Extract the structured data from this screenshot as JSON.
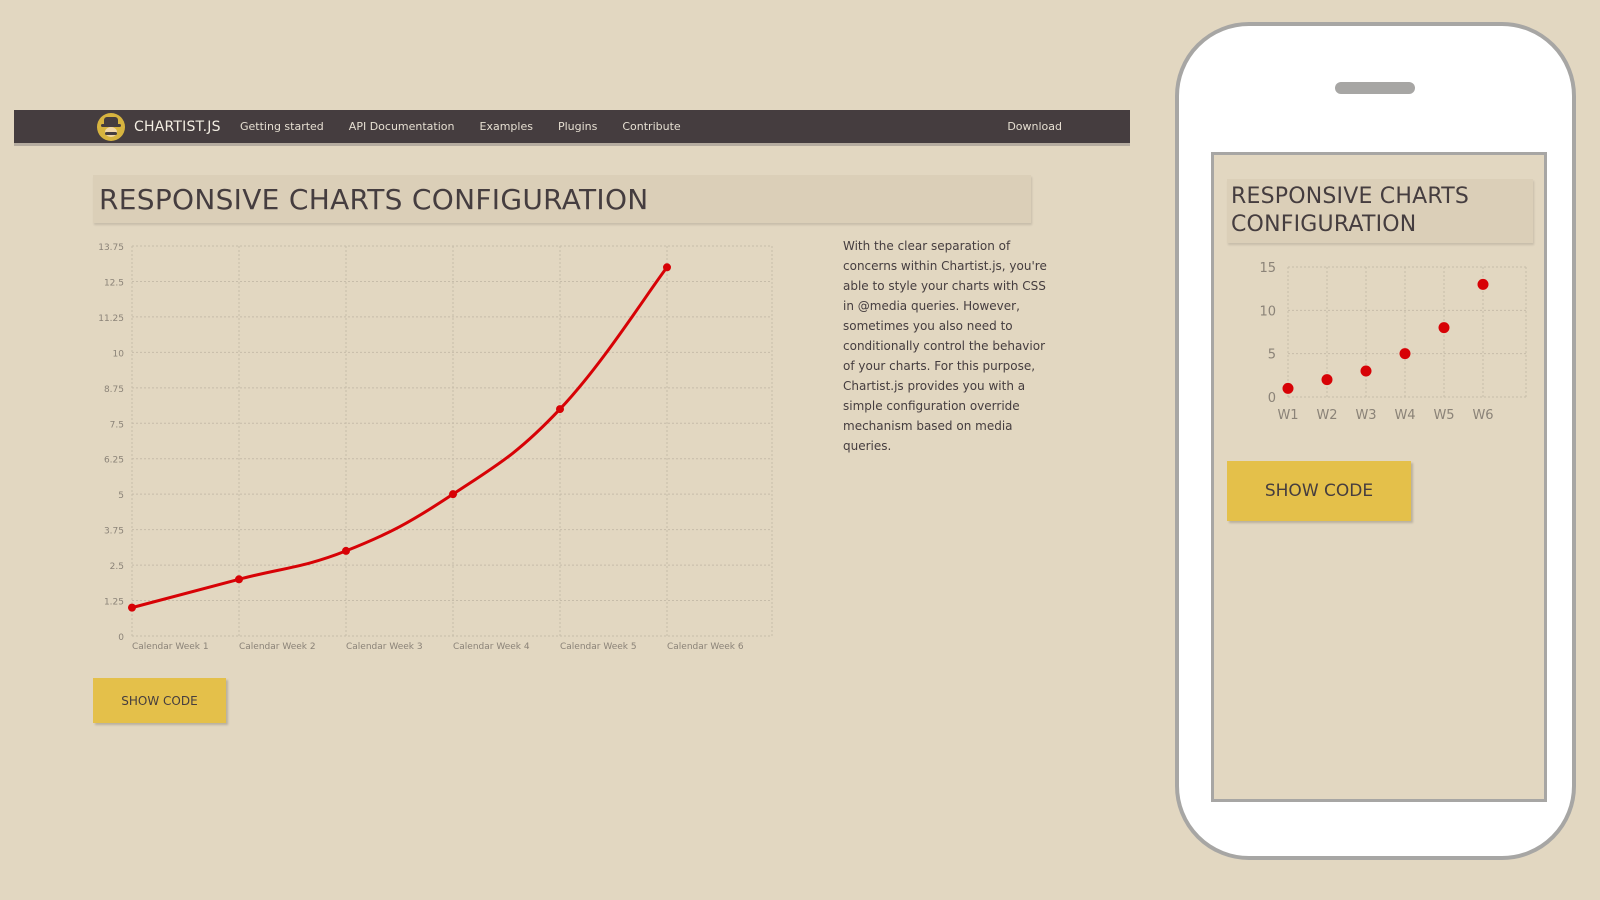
{
  "navbar": {
    "logo_text": "CHARTIST.JS",
    "links": [
      "Getting started",
      "API Documentation",
      "Examples",
      "Plugins",
      "Contribute"
    ],
    "download": "Download"
  },
  "main": {
    "title": "RESPONSIVE CHARTS CONFIGURATION",
    "description": "With the clear separation of concerns within Chartist.js, you're able to style your charts with CSS in @media queries. However, sometimes you also need to conditionally control the behavior of your charts. For this purpose, Chartist.js provides you with a simple configuration override mechanism based on media queries.",
    "show_code": "SHOW CODE"
  },
  "mobile": {
    "title": "RESPONSIVE CHARTS CONFIGURATION",
    "show_code": "SHOW CODE"
  },
  "colors": {
    "background": "#e2d7c1",
    "navbar": "#453d3f",
    "series": "#d70206",
    "button": "#e4c04a",
    "title_box": "#dbcfb8"
  },
  "chart_data": [
    {
      "type": "line",
      "categories": [
        "Calendar Week 1",
        "Calendar Week 2",
        "Calendar Week 3",
        "Calendar Week 4",
        "Calendar Week 5",
        "Calendar Week 6"
      ],
      "series": [
        {
          "values": [
            1,
            2,
            3,
            5,
            8,
            13
          ]
        }
      ],
      "yticks": [
        "0",
        "1.25",
        "2.5",
        "3.75",
        "5",
        "6.25",
        "7.5",
        "8.75",
        "10",
        "11.25",
        "12.5",
        "13.75"
      ],
      "ylim": [
        0,
        13.75
      ],
      "grid": true,
      "smooth": true
    },
    {
      "type": "scatter",
      "categories": [
        "W1",
        "W2",
        "W3",
        "W4",
        "W5",
        "W6"
      ],
      "series": [
        {
          "values": [
            1,
            2,
            3,
            5,
            8,
            13
          ]
        }
      ],
      "yticks": [
        "0",
        "5",
        "10",
        "15"
      ],
      "ylim": [
        0,
        15
      ],
      "grid": true
    }
  ]
}
